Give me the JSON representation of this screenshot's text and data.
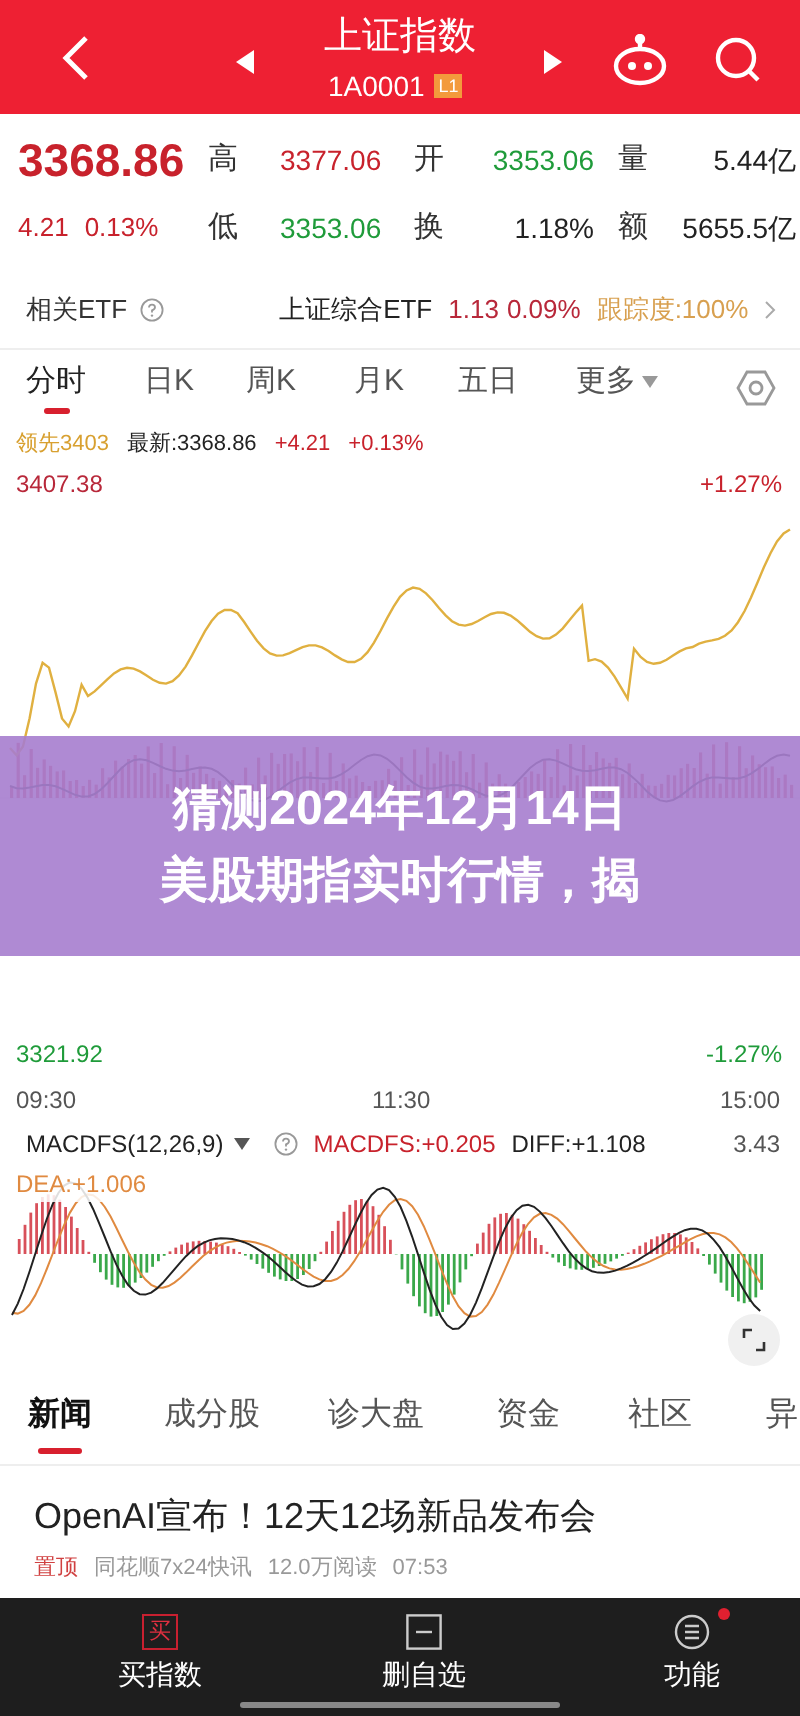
{
  "header": {
    "title": "上证指数",
    "code": "1A0001",
    "level_badge": "L1"
  },
  "quote": {
    "price": "3368.86",
    "change": "4.21",
    "change_pct": "0.13%",
    "stats": [
      {
        "label": "高",
        "value": "3377.06",
        "color": "#c8222c"
      },
      {
        "label": "开",
        "value": "3353.06",
        "color": "#1f9b3a"
      },
      {
        "label": "量",
        "value": "5.44亿",
        "color": "#222222"
      },
      {
        "label": "低",
        "value": "3353.06",
        "color": "#1f9b3a"
      },
      {
        "label": "换",
        "value": "1.18%",
        "color": "#222222"
      },
      {
        "label": "额",
        "value": "5655.5亿",
        "color": "#222222"
      }
    ]
  },
  "etf": {
    "label": "相关ETF",
    "name": "上证综合ETF",
    "price": "1.13",
    "pct": "0.09%",
    "tracking": "跟踪度:100%"
  },
  "chart_tabs": [
    {
      "label": "分时",
      "selected": true,
      "kind": "tab"
    },
    {
      "label": "日K",
      "selected": false,
      "kind": "tab"
    },
    {
      "label": "周K",
      "selected": false,
      "kind": "tab"
    },
    {
      "label": "月K",
      "selected": false,
      "kind": "tab"
    },
    {
      "label": "五日",
      "selected": false,
      "kind": "tab"
    },
    {
      "label": "更多",
      "selected": false,
      "kind": "dropdown"
    }
  ],
  "chart": {
    "leader": "领先3403",
    "latest": "最新:3368.86",
    "change": "+4.21",
    "pct": "+0.13%",
    "high": "3407.38",
    "high_pct": "+1.27%",
    "low": "3321.92",
    "low_pct": "-1.27%",
    "times": [
      "09:30",
      "11:30",
      "15:00"
    ]
  },
  "macd": {
    "name": "MACDFS(12,26,9)",
    "value": "MACDFS:+0.205",
    "diff": "DIFF:+1.108",
    "dea": "DEA:+1.006",
    "scale": "3.43"
  },
  "banner": {
    "lines": [
      "猜测2024年12月14日",
      "美股期指实时行情，揭"
    ]
  },
  "news_tabs": [
    {
      "label": "新闻",
      "selected": true
    },
    {
      "label": "成分股",
      "selected": false
    },
    {
      "label": "诊大盘",
      "selected": false
    },
    {
      "label": "资金",
      "selected": false
    },
    {
      "label": "社区",
      "selected": false
    },
    {
      "label": "异",
      "selected": false
    }
  ],
  "news": {
    "headline": "OpenAI宣布！12天12场新品发布会",
    "pinned": "置顶",
    "source": "同花顺7x24快讯",
    "reads": "12.0万阅读",
    "time": "07:53"
  },
  "bottom_nav": [
    {
      "label": "买指数",
      "kind": "buy",
      "icon_text": "买",
      "badge": false
    },
    {
      "label": "删自选",
      "kind": "remove",
      "badge": false
    },
    {
      "label": "功能",
      "kind": "menu",
      "badge": true
    }
  ]
}
